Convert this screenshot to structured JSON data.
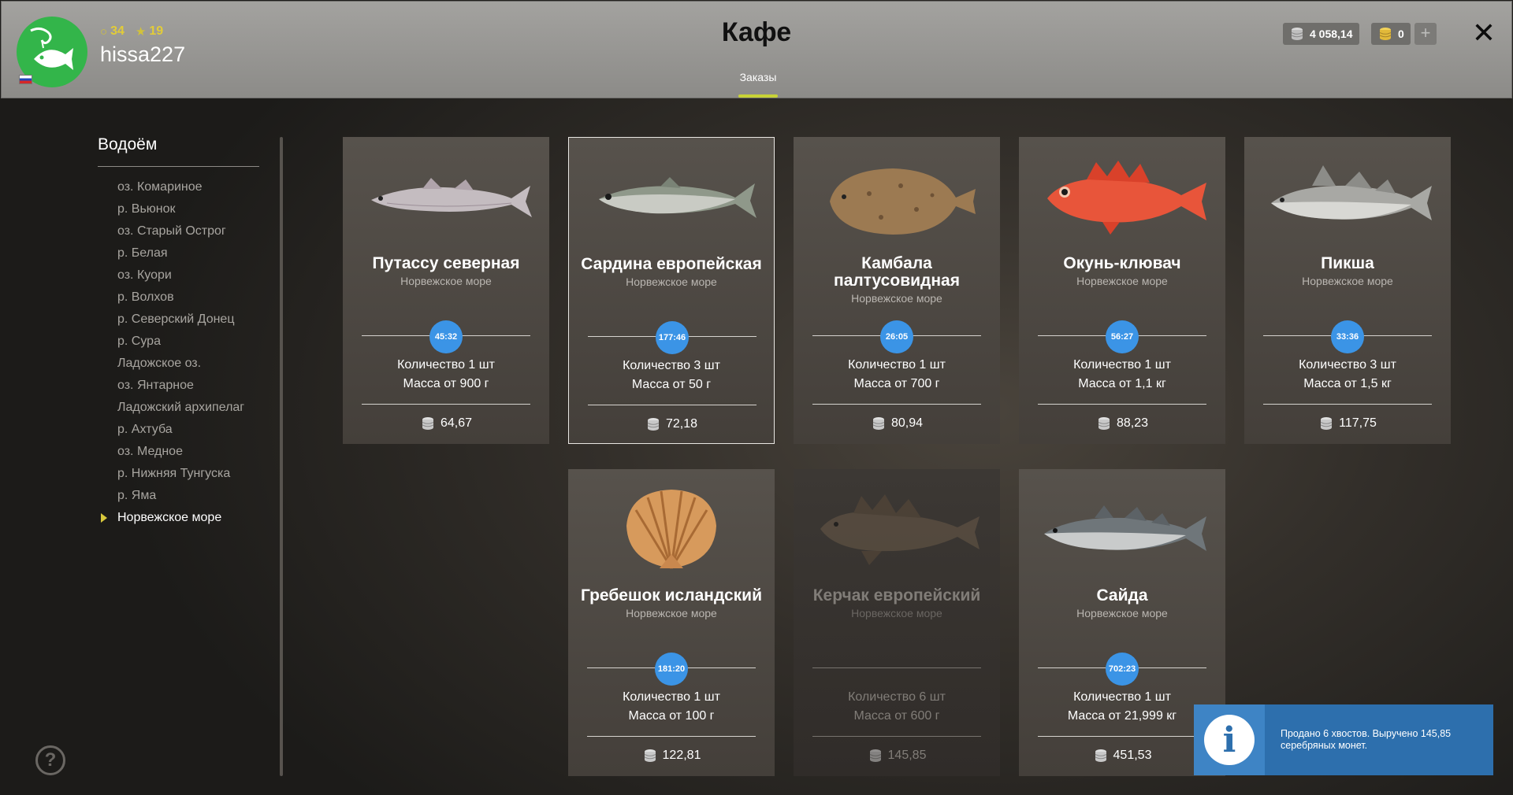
{
  "header": {
    "title": "Кафе",
    "username": "hissa227",
    "level": "34",
    "rank": "19",
    "tab_orders": "Заказы",
    "silver": "4 058,14",
    "gold": "0",
    "add_label": "+",
    "close_label": "✕",
    "accent": "#c8d236"
  },
  "sidebar": {
    "title": "Водоём",
    "items": [
      "оз. Комариное",
      "р. Вьюнок",
      "оз. Старый Острог",
      "р. Белая",
      "оз. Куори",
      "р. Волхов",
      "р. Северский Донец",
      "р. Сура",
      "Ладожское оз.",
      "оз. Янтарное",
      "Ладожский архипелаг",
      "р. Ахтуба",
      "оз. Медное",
      "р. Нижняя Тунгуска",
      "р. Яма",
      "Норвежское море"
    ],
    "active_item": "Норвежское море",
    "help_label": "?"
  },
  "orders": [
    {
      "name": "Путассу северная",
      "location": "Норвежское море",
      "timer": "45:32",
      "quantity": "Количество 1 шт",
      "mass": "Масса от 900 г",
      "price": "64,67",
      "icon": "blue-whiting-fish-icon"
    },
    {
      "name": "Сардина европейская",
      "location": "Норвежское море",
      "timer": "177:46",
      "quantity": "Количество 3 шт",
      "mass": "Масса от 50 г",
      "price": "72,18",
      "icon": "sardine-fish-icon"
    },
    {
      "name": "Камбала палтусовидная",
      "location": "Норвежское море",
      "timer": "26:05",
      "quantity": "Количество 1 шт",
      "mass": "Масса от 700 г",
      "price": "80,94",
      "icon": "flounder-fish-icon"
    },
    {
      "name": "Окунь-клювач",
      "location": "Норвежское море",
      "timer": "56:27",
      "quantity": "Количество 1 шт",
      "mass": "Масса от 1,1 кг",
      "price": "88,23",
      "icon": "redfish-icon"
    },
    {
      "name": "Пикша",
      "location": "Норвежское море",
      "timer": "33:36",
      "quantity": "Количество 3 шт",
      "mass": "Масса от 1,5 кг",
      "price": "117,75",
      "icon": "haddock-fish-icon"
    },
    {
      "name": "Гребешок исландский",
      "location": "Норвежское море",
      "timer": "181:20",
      "quantity": "Количество 1 шт",
      "mass": "Масса от 100 г",
      "price": "122,81",
      "icon": "scallop-shell-icon"
    },
    {
      "name": "Керчак европейский",
      "location": "Норвежское море",
      "timer": "",
      "quantity": "Количество 6 шт",
      "mass": "Масса от 600 г",
      "price": "145,85",
      "icon": "sculpin-fish-icon"
    },
    {
      "name": "Сайда",
      "location": "Норвежское море",
      "timer": "702:23",
      "quantity": "Количество 1 шт",
      "mass": "Масса от 21,999 кг",
      "price": "451,53",
      "icon": "pollock-fish-icon"
    }
  ],
  "notification": {
    "text": "Продано 6 хвостов. Выручено 145,85 серебряных монет.",
    "icon": "info-icon"
  }
}
